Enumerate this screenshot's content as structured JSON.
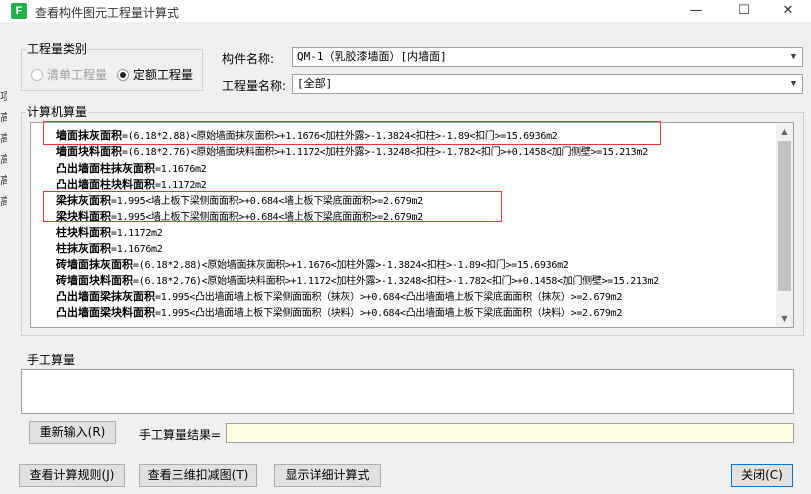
{
  "window": {
    "app_icon_glyph": "F",
    "title": "查看构件图元工程量计算式",
    "minimize_glyph": "—",
    "maximize_glyph": "☐",
    "close_glyph": "✕"
  },
  "left_edge_text": [
    "项",
    "高",
    "高",
    "高",
    "高",
    "高"
  ],
  "quantity_type": {
    "label": "工程量类别",
    "options": [
      {
        "label": "清单工程量",
        "selected": false,
        "enabled": false
      },
      {
        "label": "定额工程量",
        "selected": true,
        "enabled": true
      }
    ]
  },
  "component_name": {
    "label": "构件名称:",
    "value": "QM-1（乳胶漆墙面）[内墙面]"
  },
  "quantity_name": {
    "label": "工程量名称:",
    "value": "[全部]"
  },
  "computer_calc": {
    "label": "计算机算量",
    "lines": [
      {
        "name": "墙面抹灰面积",
        "formula": "=(6.18*2.88)<原始墙面抹灰面积>+1.1676<加柱外露>-1.3824<扣柱>-1.89<扣门>=15.6936m2"
      },
      {
        "name": "墙面块料面积",
        "formula": "=(6.18*2.76)<原始墙面块料面积>+1.1172<加柱外露>-1.3248<扣柱>-1.782<扣门>+0.1458<加门侧壁>=15.213m2"
      },
      {
        "name": "凸出墙面柱抹灰面积",
        "formula": "=1.1676m2"
      },
      {
        "name": "凸出墙面柱块料面积",
        "formula": "=1.1172m2"
      },
      {
        "name": "梁抹灰面积",
        "formula": "=1.995<墙上板下梁侧面面积>+0.684<墙上板下梁底面面积>=2.679m2"
      },
      {
        "name": "梁块料面积",
        "formula": "=1.995<墙上板下梁侧面面积>+0.684<墙上板下梁底面面积>=2.679m2"
      },
      {
        "name": "柱块料面积",
        "formula": "=1.1172m2"
      },
      {
        "name": "柱抹灰面积",
        "formula": "=1.1676m2"
      },
      {
        "name": "砖墙面抹灰面积",
        "formula": "=(6.18*2.88)<原始墙面抹灰面积>+1.1676<加柱外露>-1.3824<扣柱>-1.89<扣门>=15.6936m2"
      },
      {
        "name": "砖墙面块料面积",
        "formula": "=(6.18*2.76)<原始墙面块料面积>+1.1172<加柱外露>-1.3248<扣柱>-1.782<扣门>+0.1458<加门侧壁>=15.213m2"
      },
      {
        "name": "凸出墙面梁抹灰面积",
        "formula": "=1.995<凸出墙面墙上板下梁侧面面积（抹灰）>+0.684<凸出墙面墙上板下梁底面面积（抹灰）>=2.679m2"
      },
      {
        "name": "凸出墙面梁块料面积",
        "formula": "=1.995<凸出墙面墙上板下梁侧面面积（块料）>+0.684<凸出墙面墙上板下梁底面面积（块料）>=2.679m2"
      }
    ]
  },
  "manual_calc": {
    "label": "手工算量",
    "reinput_button": "重新输入(R)",
    "result_label": "手工算量结果=",
    "result_value": ""
  },
  "footer": {
    "view_rules_button": "查看计算规则(J)",
    "view_3d_button": "查看三维扣减图(T)",
    "show_detail_button": "显示详细计算式",
    "close_button": "关闭(C)"
  },
  "colors": {
    "highlight_box": "#e53935",
    "app_icon": "#22b14c",
    "result_field_bg": "#fffde6"
  }
}
